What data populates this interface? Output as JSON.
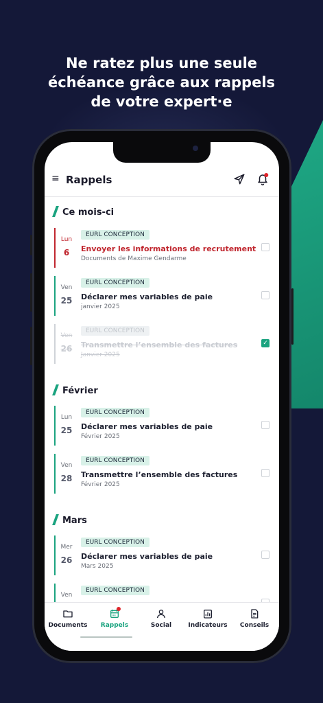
{
  "headline": {
    "line1": "Ne ratez plus une seule",
    "line2": "échéance grâce aux rappels",
    "line3": "de votre expert·e"
  },
  "appbar": {
    "title": "Rappels",
    "icons": [
      "menu-icon",
      "send-icon",
      "bell-icon"
    ]
  },
  "sections": [
    {
      "title": "Ce mois-ci",
      "items": [
        {
          "day": "Lun",
          "date": "6",
          "badge": "EURL CONCEPTION",
          "title": "Envoyer les informations de recrutement",
          "sub": "Documents de Maxime Gendarme",
          "state": "urgent",
          "checked": false
        },
        {
          "day": "Ven",
          "date": "25",
          "badge": "EURL CONCEPTION",
          "title": "Déclarer mes variables de paie",
          "sub": "janvier 2025",
          "state": "normal",
          "checked": false
        },
        {
          "day": "Ven",
          "date": "26",
          "badge": "EURL CONCEPTION",
          "title": "Transmettre l’ensemble des factures",
          "sub": "Janvier 2025",
          "state": "done",
          "checked": true
        }
      ]
    },
    {
      "title": "Février",
      "items": [
        {
          "day": "Lun",
          "date": "25",
          "badge": "EURL CONCEPTION",
          "title": "Déclarer mes variables de paie",
          "sub": "Février 2025",
          "state": "normal",
          "checked": false
        },
        {
          "day": "Ven",
          "date": "28",
          "badge": "EURL CONCEPTION",
          "title": "Transmettre l’ensemble des factures",
          "sub": "Février 2025",
          "state": "normal",
          "checked": false
        }
      ]
    },
    {
      "title": "Mars",
      "items": [
        {
          "day": "Mer",
          "date": "26",
          "badge": "EURL CONCEPTION",
          "title": "Déclarer mes variables de paie",
          "sub": "Mars 2025",
          "state": "normal",
          "checked": false
        },
        {
          "day": "Ven",
          "date": "",
          "badge": "EURL CONCEPTION",
          "title": "",
          "sub": "",
          "state": "normal",
          "checked": false
        }
      ]
    }
  ],
  "tabs": [
    {
      "label": "Documents",
      "icon": "folder-icon",
      "active": false
    },
    {
      "label": "Rappels",
      "icon": "calendar-icon",
      "active": true
    },
    {
      "label": "Social",
      "icon": "person-icon",
      "active": false
    },
    {
      "label": "Indicateurs",
      "icon": "chart-icon",
      "active": false
    },
    {
      "label": "Conseils",
      "icon": "document-icon",
      "active": false
    }
  ],
  "colors": {
    "background": "#141838",
    "accent": "#1aa37f",
    "urgent": "#c0262e",
    "notification_dot": "#e0252b"
  }
}
